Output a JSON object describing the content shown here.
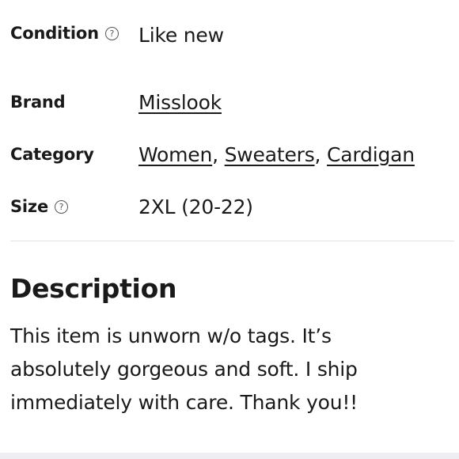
{
  "details": {
    "condition": {
      "label": "Condition",
      "help_icon": "question-circle-icon",
      "value": "Like new"
    },
    "brand": {
      "label": "Brand",
      "value": "Misslook"
    },
    "category": {
      "label": "Category",
      "links": [
        "Women",
        "Sweaters",
        "Cardigan"
      ],
      "separator": ", "
    },
    "size": {
      "label": "Size",
      "help_icon": "question-circle-icon",
      "value": "2XL (20-22)"
    }
  },
  "description": {
    "title": "Description",
    "text": "This item is unworn w/o tags. It’s\nabsolutely gorgeous and soft.  I ship\nimmediately with care. Thank you!!"
  }
}
